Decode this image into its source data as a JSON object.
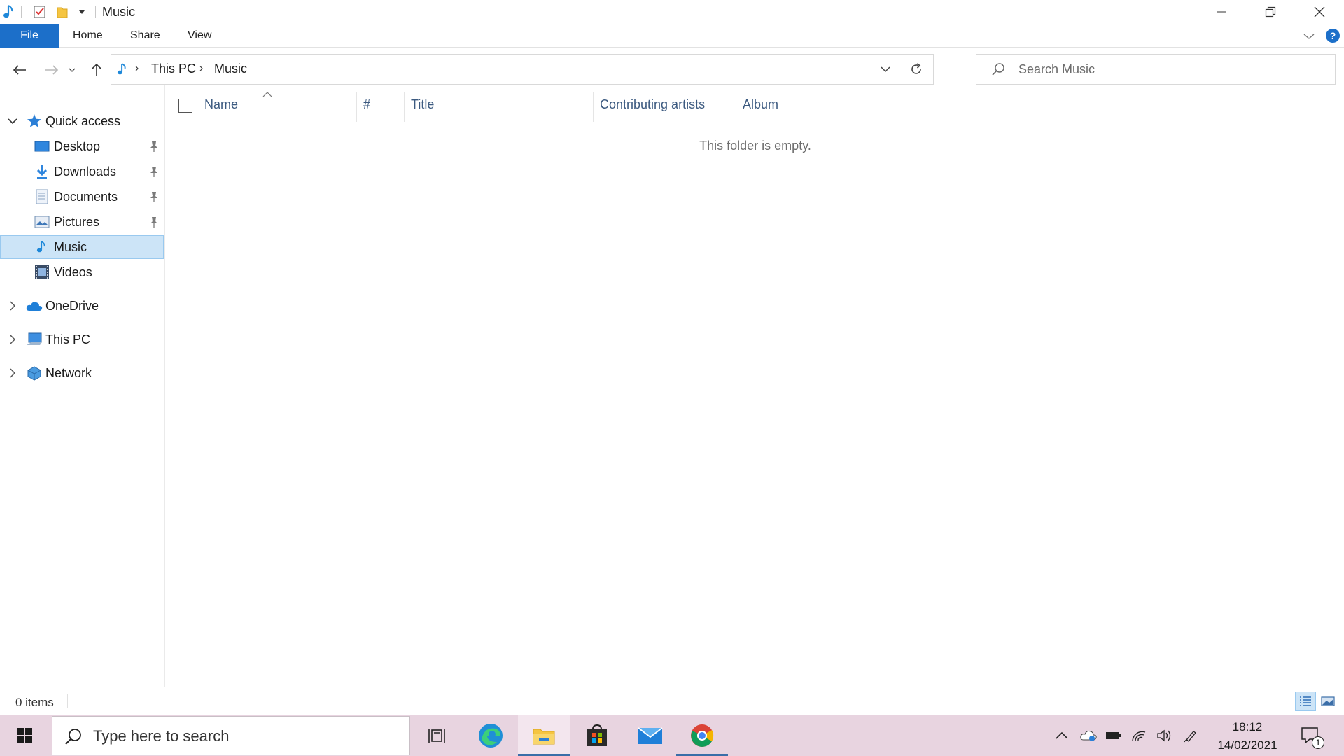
{
  "window": {
    "title": "Music"
  },
  "ribbon": {
    "tabs": [
      {
        "label": "File"
      },
      {
        "label": "Home"
      },
      {
        "label": "Share"
      },
      {
        "label": "View"
      }
    ]
  },
  "address": {
    "crumbs": [
      "This PC",
      "Music"
    ]
  },
  "search": {
    "placeholder": "Search Music"
  },
  "nav": {
    "quick_access": "Quick access",
    "items": [
      {
        "label": "Desktop",
        "icon": "desktop-icon",
        "pinned": true
      },
      {
        "label": "Downloads",
        "icon": "downloads-icon",
        "pinned": true
      },
      {
        "label": "Documents",
        "icon": "documents-icon",
        "pinned": true
      },
      {
        "label": "Pictures",
        "icon": "pictures-icon",
        "pinned": true
      },
      {
        "label": "Music",
        "icon": "music-icon",
        "pinned": false,
        "selected": true
      },
      {
        "label": "Videos",
        "icon": "videos-icon",
        "pinned": false
      }
    ],
    "onedrive": "OneDrive",
    "this_pc": "This PC",
    "network": "Network"
  },
  "columns": {
    "name": "Name",
    "number": "#",
    "title": "Title",
    "artists": "Contributing artists",
    "album": "Album"
  },
  "content": {
    "empty_message": "This folder is empty."
  },
  "status": {
    "item_count": "0 items"
  },
  "taskbar": {
    "search_placeholder": "Type here to search",
    "time": "18:12",
    "date": "14/02/2021",
    "notification_count": "1"
  },
  "colors": {
    "accent": "#1c6fc9",
    "selection": "#cce4f7",
    "taskbar": "#e8d4e0"
  }
}
